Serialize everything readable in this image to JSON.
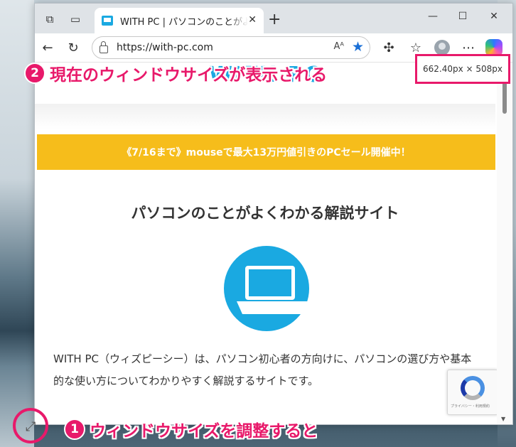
{
  "browser": {
    "tab_title": "WITH PC | パソコンのことがよくわかる解説サイト",
    "tab_close": "✕",
    "new_tab": "+",
    "window_controls": [
      "—",
      "☐",
      "✕"
    ],
    "url": "https://with-pc.com",
    "read_aloud": "Aᴬ",
    "favorite": "★"
  },
  "page": {
    "logo": "WITH PC",
    "banner": "《7/16まで》mouseで最大13万円値引きのPCセール開催中！",
    "site_title": "パソコンのことがよくわかる解説サイト",
    "description": "WITH PC（ウィズピーシー）は、パソコン初心者の方向けに、パソコンの選び方や基本的な使い方についてわかりやすく解説するサイトです。",
    "recaptcha_text": "プライバシー・利用規約"
  },
  "overlay": {
    "size_readout": "662.40px × 508px",
    "callout1_num": "1",
    "callout1_text": "ウィンドウサイズを調整すると",
    "callout2_num": "2",
    "callout2_text": "現在のウィンドウサイズが表示される"
  },
  "colors": {
    "accent": "#e8196a",
    "brand": "#1aa9e1",
    "banner": "#f6bd1b"
  }
}
